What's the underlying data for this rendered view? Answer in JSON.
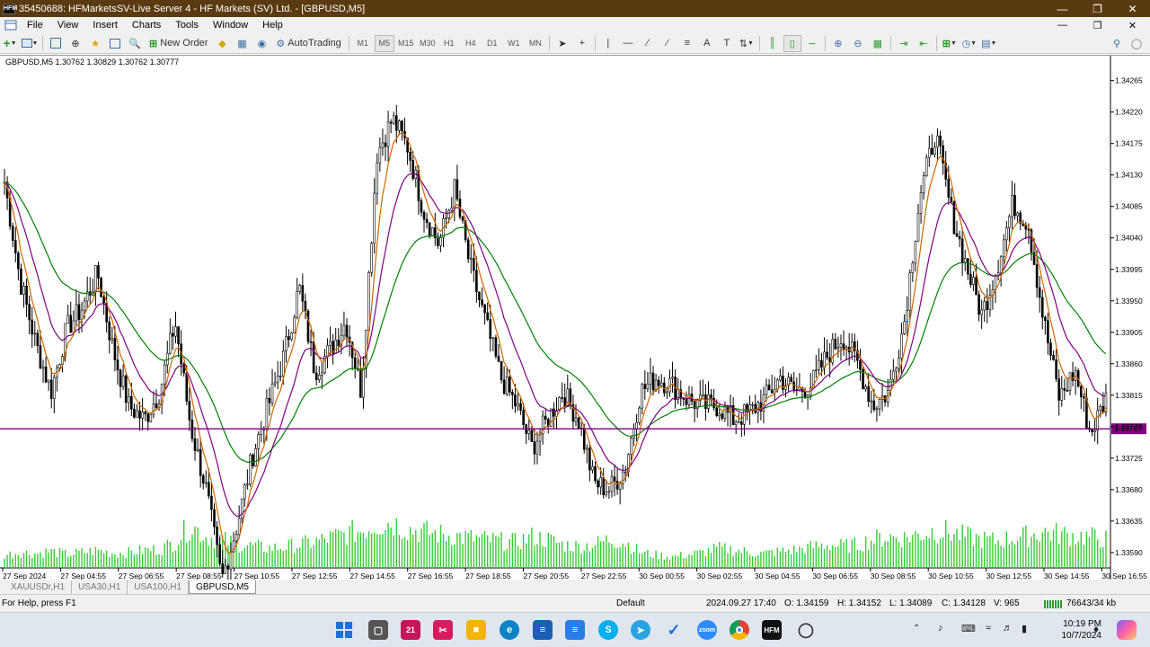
{
  "window": {
    "title": "35450688: HFMarketsSV-Live Server 4 - HF Markets (SV) Ltd. - [GBPUSD,M5]",
    "app_icon": "HFM",
    "controls": [
      "minimize-icon",
      "restore-icon",
      "close-icon"
    ]
  },
  "menu": {
    "items": [
      "File",
      "View",
      "Insert",
      "Charts",
      "Tools",
      "Window",
      "Help"
    ],
    "controls": [
      "minimize-icon",
      "restore-icon",
      "close-icon"
    ]
  },
  "toolbar": {
    "new_order": "New Order",
    "autotrading": "AutoTrading",
    "timeframes": [
      "M1",
      "M5",
      "M15",
      "M30",
      "H1",
      "H4",
      "D1",
      "W1",
      "MN"
    ],
    "active_timeframe": "M5"
  },
  "chart": {
    "header": "GBPUSD,M5  1.30762 1.30829 1.30762 1.30777",
    "current_price": "1.33767",
    "colors": {
      "candle": "#000000",
      "ma_fast": "#cc6600",
      "ma_mid": "#800080",
      "ma_slow": "#008000",
      "volume": "#32cd32",
      "price_line": "#800080"
    }
  },
  "chart_data": {
    "type": "candlestick",
    "symbol": "GBPUSD",
    "timeframe": "M5",
    "y_ticks": [
      "1.34265",
      "1.34220",
      "1.34175",
      "1.34130",
      "1.34085",
      "1.34040",
      "1.33995",
      "1.33950",
      "1.33905",
      "1.33860",
      "1.33815",
      "1.33770",
      "1.33725",
      "1.33680",
      "1.33635",
      "1.33590"
    ],
    "x_ticks": [
      "27 Sep 2024",
      "27 Sep 04:55",
      "27 Sep 06:55",
      "27 Sep 08:55",
      "27 Sep 10:55",
      "27 Sep 12:55",
      "27 Sep 14:55",
      "27 Sep 16:55",
      "27 Sep 18:55",
      "27 Sep 20:55",
      "27 Sep 22:55",
      "30 Sep 00:55",
      "30 Sep 02:55",
      "30 Sep 04:55",
      "30 Sep 06:55",
      "30 Sep 08:55",
      "30 Sep 10:55",
      "30 Sep 12:55",
      "30 Sep 14:55",
      "30 Sep 16:55"
    ],
    "ylim": [
      1.33568,
      1.34298
    ],
    "price_path": [
      1.3412,
      1.3398,
      1.3389,
      1.3382,
      1.3391,
      1.3394,
      1.3399,
      1.3388,
      1.338,
      1.3378,
      1.3382,
      1.3392,
      1.3377,
      1.3368,
      1.3355,
      1.3363,
      1.3373,
      1.338,
      1.3387,
      1.3397,
      1.3385,
      1.3388,
      1.3392,
      1.3382,
      1.3416,
      1.3421,
      1.3417,
      1.3408,
      1.3403,
      1.3411,
      1.34,
      1.3392,
      1.3384,
      1.338,
      1.3374,
      1.3378,
      1.3382,
      1.3378,
      1.3369,
      1.3368,
      1.3371,
      1.3382,
      1.3384,
      1.3383,
      1.3381,
      1.338,
      1.338,
      1.3378,
      1.3379,
      1.3381,
      1.3384,
      1.3382,
      1.3383,
      1.3387,
      1.339,
      1.3386,
      1.338,
      1.3382,
      1.3392,
      1.341,
      1.3419,
      1.3408,
      1.34,
      1.3393,
      1.34,
      1.3409,
      1.3406,
      1.3392,
      1.3381,
      1.3385,
      1.3376,
      1.3381
    ],
    "volume_levels": [
      0.25,
      0.3,
      0.28,
      0.32,
      0.26,
      0.3,
      0.34,
      0.28,
      0.3,
      0.34,
      0.36,
      0.5,
      0.82,
      0.6,
      0.55,
      0.45,
      0.42,
      0.38,
      0.4,
      0.45,
      0.5,
      0.58,
      0.65,
      0.72,
      0.85,
      0.88,
      0.75,
      0.7,
      0.65,
      0.62,
      0.58,
      0.55,
      0.52,
      0.5,
      0.6,
      0.55,
      0.45,
      0.42,
      0.45,
      0.55,
      0.5,
      0.3,
      0.25,
      0.22,
      0.25,
      0.3,
      0.38,
      0.35,
      0.3,
      0.28,
      0.32,
      0.35,
      0.4,
      0.45,
      0.42,
      0.45,
      0.55,
      0.6,
      0.58,
      0.65,
      0.72,
      0.68,
      0.6,
      0.55,
      0.52,
      0.58,
      0.62,
      0.7,
      0.65,
      0.62,
      0.6,
      0.55
    ],
    "current_price": 1.33767
  },
  "tabs": [
    "XAUUSDr,H1",
    "USA30,H1",
    "USA100,H1",
    "GBPUSD,M5"
  ],
  "active_tab": "GBPUSD,M5",
  "status": {
    "help": "For Help, press F1",
    "profile": "Default",
    "datetime": "2024.09.27 17:40",
    "open": "O: 1.34159",
    "high": "H: 1.34152",
    "low": "L: 1.34089",
    "close": "C: 1.34128",
    "volume": "V: 965",
    "traffic": "76643/34 kb"
  },
  "taskbar": {
    "apps": [
      "start",
      "files",
      "calendar",
      "snip",
      "explorer",
      "edge",
      "calculator",
      "notepad",
      "skype",
      "telegram",
      "todo",
      "zoom",
      "chrome",
      "hfm",
      "metatrader"
    ],
    "time": "10:19 PM",
    "date": "10/7/2024"
  }
}
